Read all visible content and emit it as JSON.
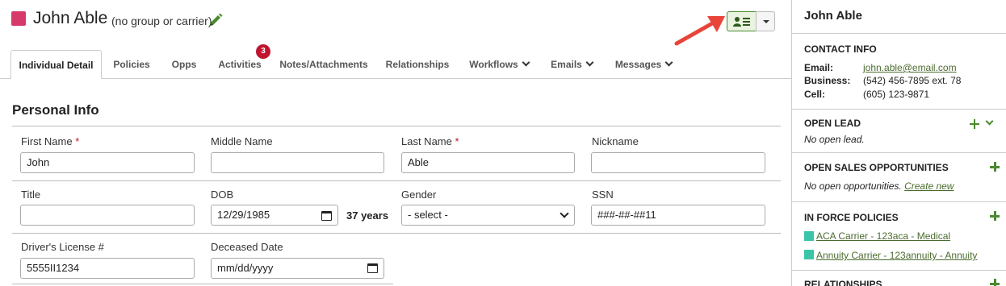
{
  "header": {
    "contact_name": "John Able",
    "group_text": "(no group or carrier)",
    "edit_icon": "pencil-icon",
    "vcard_icon": "contact-card-icon",
    "accent_color": "#d63a6a"
  },
  "tabs": [
    {
      "label": "Individual Detail",
      "active": true
    },
    {
      "label": "Policies"
    },
    {
      "label": "Opps"
    },
    {
      "label": "Activities",
      "badge": "3"
    },
    {
      "label": "Notes/Attachments"
    },
    {
      "label": "Relationships"
    },
    {
      "label": "Workflows",
      "dropdown": true
    },
    {
      "label": "Emails",
      "dropdown": true
    },
    {
      "label": "Messages",
      "dropdown": true
    }
  ],
  "personal_info": {
    "title": "Personal Info",
    "required_marker": "*",
    "first_name": {
      "label": "First Name",
      "value": "John"
    },
    "middle_name": {
      "label": "Middle Name",
      "value": ""
    },
    "last_name": {
      "label": "Last Name",
      "value": "Able"
    },
    "nickname": {
      "label": "Nickname",
      "value": ""
    },
    "title_field": {
      "label": "Title",
      "value": ""
    },
    "dob": {
      "label": "DOB",
      "value": "12/29/1985",
      "age": "37 years"
    },
    "gender": {
      "label": "Gender",
      "value": "- select -"
    },
    "ssn": {
      "label": "SSN",
      "value": "###-##-##11"
    },
    "drivers_license": {
      "label": "Driver's License #",
      "value": "5555II1234"
    },
    "deceased_date": {
      "label": "Deceased Date",
      "value": "mm/dd/yyyy"
    }
  },
  "sidebar": {
    "name": "John Able",
    "contact_info": {
      "heading": "CONTACT INFO",
      "email_label": "Email:",
      "email_value": "john.able@email.com",
      "business_label": "Business:",
      "business_value": "(542) 456-7895 ext. 78",
      "cell_label": "Cell:",
      "cell_value": "(605) 123-9871"
    },
    "open_lead": {
      "heading": "OPEN LEAD",
      "text": "No open lead."
    },
    "open_sales": {
      "heading": "OPEN SALES OPPORTUNITIES",
      "text": "No open opportunities.",
      "link": "Create new"
    },
    "in_force": {
      "heading": "IN FORCE POLICIES",
      "policies": [
        "ACA Carrier - 123aca - Medical",
        "Annuity Carrier - 123annuity - Annuity"
      ]
    },
    "relationships": {
      "heading": "RELATIONSHIPS"
    }
  },
  "colors": {
    "link_green": "#4b6b2e",
    "action_green": "#4a8a2f",
    "badge_red": "#c0152f",
    "policy_teal": "#3cc4a8"
  }
}
